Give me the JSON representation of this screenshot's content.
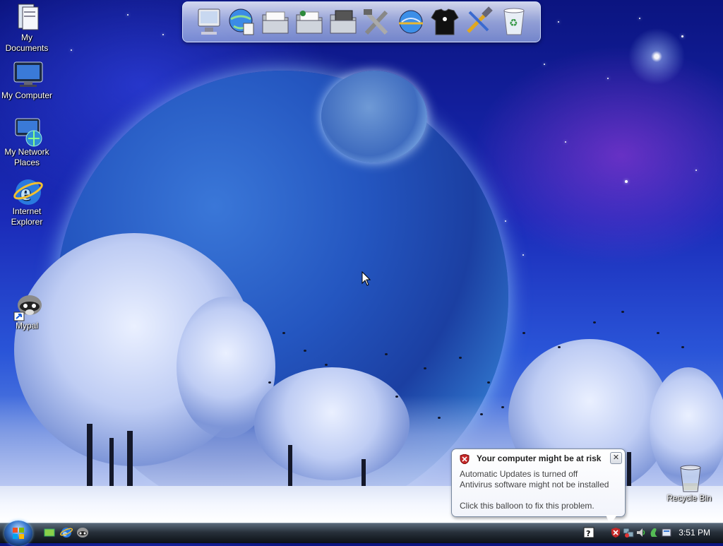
{
  "desktop_icons": [
    {
      "label": "My Documents",
      "icon": "my-documents-icon"
    },
    {
      "label": "My Computer",
      "icon": "my-computer-icon"
    },
    {
      "label": "My Network Places",
      "icon": "network-places-icon"
    },
    {
      "label": "Internet Explorer",
      "icon": "internet-explorer-icon"
    },
    {
      "label": "Mypal",
      "icon": "mypal-raccoon-icon"
    },
    {
      "label": "Recycle Bin",
      "icon": "recycle-bin-icon"
    }
  ],
  "dock_items": [
    "computer-icon",
    "network-globe-icon",
    "folder-icon",
    "folder-music-icon",
    "folder-pictures-icon",
    "tools-icon",
    "globe-connect-icon",
    "tshirt-icon",
    "hammer-wrench-icon",
    "recycle-bin-icon"
  ],
  "taskbar": {
    "start_icon": "windows-start-orb",
    "quick_launch": [
      "show-desktop-icon",
      "internet-explorer-icon",
      "mypal-icon"
    ],
    "tray_icons": [
      "help-icon",
      "security-alert-icon",
      "network-icon",
      "volume-icon",
      "updates-icon",
      "app-icon"
    ],
    "clock": "3:51 PM"
  },
  "balloon": {
    "title": "Your computer might be at risk",
    "line1": "Automatic Updates is turned off",
    "line2": "Antivirus software might not be installed",
    "line3": "Click this balloon to fix this problem.",
    "close_label": "✕"
  },
  "colors": {
    "sky_top": "#0b1480",
    "sky_bottom": "#9db6ec",
    "taskbar": "#1a2028",
    "shield_red": "#c62828"
  }
}
